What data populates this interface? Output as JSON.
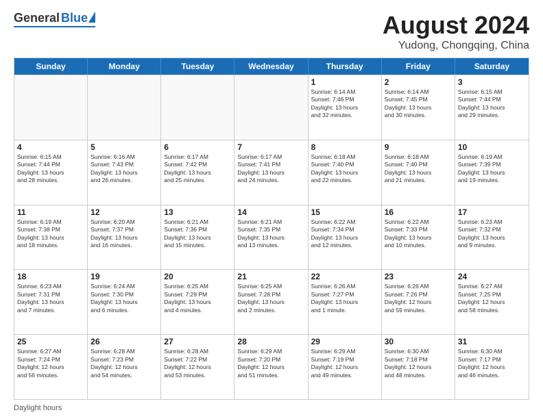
{
  "header": {
    "logo_general": "General",
    "logo_blue": "Blue",
    "main_title": "August 2024",
    "subtitle": "Yudong, Chongqing, China"
  },
  "weekdays": [
    "Sunday",
    "Monday",
    "Tuesday",
    "Wednesday",
    "Thursday",
    "Friday",
    "Saturday"
  ],
  "footer_text": "Daylight hours",
  "weeks": [
    [
      {
        "day": "",
        "text": "",
        "empty": true
      },
      {
        "day": "",
        "text": "",
        "empty": true
      },
      {
        "day": "",
        "text": "",
        "empty": true
      },
      {
        "day": "",
        "text": "",
        "empty": true
      },
      {
        "day": "1",
        "text": "Sunrise: 6:14 AM\nSunset: 7:46 PM\nDaylight: 13 hours\nand 32 minutes.",
        "empty": false
      },
      {
        "day": "2",
        "text": "Sunrise: 6:14 AM\nSunset: 7:45 PM\nDaylight: 13 hours\nand 30 minutes.",
        "empty": false
      },
      {
        "day": "3",
        "text": "Sunrise: 6:15 AM\nSunset: 7:44 PM\nDaylight: 13 hours\nand 29 minutes.",
        "empty": false
      }
    ],
    [
      {
        "day": "4",
        "text": "Sunrise: 6:15 AM\nSunset: 7:44 PM\nDaylight: 13 hours\nand 28 minutes.",
        "empty": false
      },
      {
        "day": "5",
        "text": "Sunrise: 6:16 AM\nSunset: 7:43 PM\nDaylight: 13 hours\nand 26 minutes.",
        "empty": false
      },
      {
        "day": "6",
        "text": "Sunrise: 6:17 AM\nSunset: 7:42 PM\nDaylight: 13 hours\nand 25 minutes.",
        "empty": false
      },
      {
        "day": "7",
        "text": "Sunrise: 6:17 AM\nSunset: 7:41 PM\nDaylight: 13 hours\nand 24 minutes.",
        "empty": false
      },
      {
        "day": "8",
        "text": "Sunrise: 6:18 AM\nSunset: 7:40 PM\nDaylight: 13 hours\nand 22 minutes.",
        "empty": false
      },
      {
        "day": "9",
        "text": "Sunrise: 6:18 AM\nSunset: 7:40 PM\nDaylight: 13 hours\nand 21 minutes.",
        "empty": false
      },
      {
        "day": "10",
        "text": "Sunrise: 6:19 AM\nSunset: 7:39 PM\nDaylight: 13 hours\nand 19 minutes.",
        "empty": false
      }
    ],
    [
      {
        "day": "11",
        "text": "Sunrise: 6:19 AM\nSunset: 7:38 PM\nDaylight: 13 hours\nand 18 minutes.",
        "empty": false
      },
      {
        "day": "12",
        "text": "Sunrise: 6:20 AM\nSunset: 7:37 PM\nDaylight: 13 hours\nand 16 minutes.",
        "empty": false
      },
      {
        "day": "13",
        "text": "Sunrise: 6:21 AM\nSunset: 7:36 PM\nDaylight: 13 hours\nand 15 minutes.",
        "empty": false
      },
      {
        "day": "14",
        "text": "Sunrise: 6:21 AM\nSunset: 7:35 PM\nDaylight: 13 hours\nand 13 minutes.",
        "empty": false
      },
      {
        "day": "15",
        "text": "Sunrise: 6:22 AM\nSunset: 7:34 PM\nDaylight: 13 hours\nand 12 minutes.",
        "empty": false
      },
      {
        "day": "16",
        "text": "Sunrise: 6:22 AM\nSunset: 7:33 PM\nDaylight: 13 hours\nand 10 minutes.",
        "empty": false
      },
      {
        "day": "17",
        "text": "Sunrise: 6:23 AM\nSunset: 7:32 PM\nDaylight: 13 hours\nand 9 minutes.",
        "empty": false
      }
    ],
    [
      {
        "day": "18",
        "text": "Sunrise: 6:23 AM\nSunset: 7:31 PM\nDaylight: 13 hours\nand 7 minutes.",
        "empty": false
      },
      {
        "day": "19",
        "text": "Sunrise: 6:24 AM\nSunset: 7:30 PM\nDaylight: 13 hours\nand 6 minutes.",
        "empty": false
      },
      {
        "day": "20",
        "text": "Sunrise: 6:25 AM\nSunset: 7:29 PM\nDaylight: 13 hours\nand 4 minutes.",
        "empty": false
      },
      {
        "day": "21",
        "text": "Sunrise: 6:25 AM\nSunset: 7:28 PM\nDaylight: 13 hours\nand 2 minutes.",
        "empty": false
      },
      {
        "day": "22",
        "text": "Sunrise: 6:26 AM\nSunset: 7:27 PM\nDaylight: 13 hours\nand 1 minute.",
        "empty": false
      },
      {
        "day": "23",
        "text": "Sunrise: 6:26 AM\nSunset: 7:26 PM\nDaylight: 12 hours\nand 59 minutes.",
        "empty": false
      },
      {
        "day": "24",
        "text": "Sunrise: 6:27 AM\nSunset: 7:25 PM\nDaylight: 12 hours\nand 58 minutes.",
        "empty": false
      }
    ],
    [
      {
        "day": "25",
        "text": "Sunrise: 6:27 AM\nSunset: 7:24 PM\nDaylight: 12 hours\nand 56 minutes.",
        "empty": false
      },
      {
        "day": "26",
        "text": "Sunrise: 6:28 AM\nSunset: 7:23 PM\nDaylight: 12 hours\nand 54 minutes.",
        "empty": false
      },
      {
        "day": "27",
        "text": "Sunrise: 6:28 AM\nSunset: 7:22 PM\nDaylight: 12 hours\nand 53 minutes.",
        "empty": false
      },
      {
        "day": "28",
        "text": "Sunrise: 6:29 AM\nSunset: 7:20 PM\nDaylight: 12 hours\nand 51 minutes.",
        "empty": false
      },
      {
        "day": "29",
        "text": "Sunrise: 6:29 AM\nSunset: 7:19 PM\nDaylight: 12 hours\nand 49 minutes.",
        "empty": false
      },
      {
        "day": "30",
        "text": "Sunrise: 6:30 AM\nSunset: 7:18 PM\nDaylight: 12 hours\nand 48 minutes.",
        "empty": false
      },
      {
        "day": "31",
        "text": "Sunrise: 6:30 AM\nSunset: 7:17 PM\nDaylight: 12 hours\nand 46 minutes.",
        "empty": false
      }
    ]
  ]
}
